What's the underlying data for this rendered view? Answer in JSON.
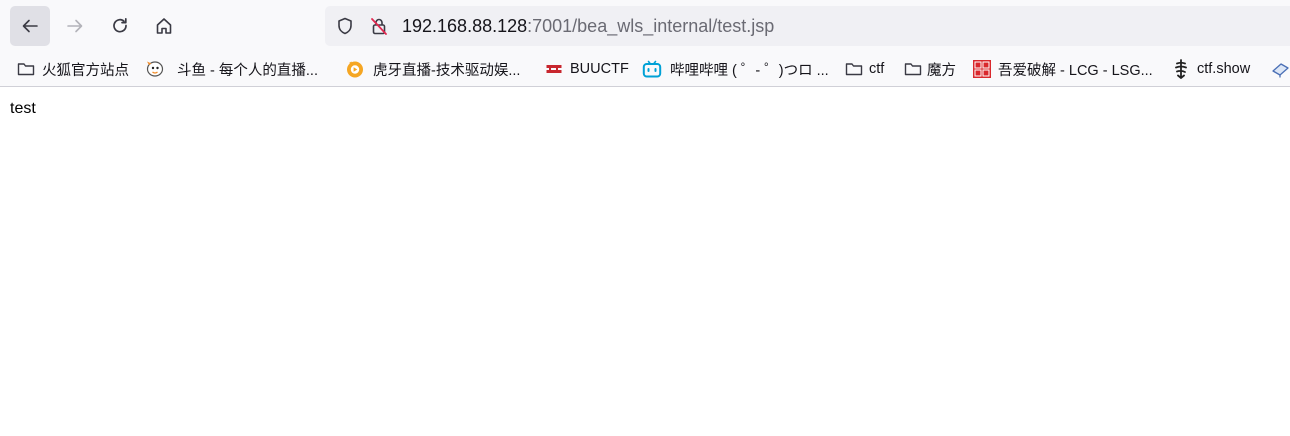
{
  "toolbar": {
    "back_icon": "arrow-left-icon",
    "forward_icon": "arrow-right-icon",
    "reload_icon": "reload-icon",
    "home_icon": "home-icon"
  },
  "urlbar": {
    "host": "192.168.88.128",
    "path": ":7001/bea_wls_internal/test.jsp",
    "shield_icon": "tracking-protection-shield-icon",
    "lock_icon": "insecure-lock-icon"
  },
  "bookmarks": [
    {
      "label": "火狐官方站点",
      "icon": "folder-icon"
    },
    {
      "label": "斗鱼 - 每个人的直播...",
      "icon": "douyu-icon"
    },
    {
      "label": "虎牙直播-技术驱动娱...",
      "icon": "huya-icon"
    },
    {
      "label": "BUUCTF",
      "icon": "buuctf-icon"
    },
    {
      "label": "哔哩哔哩 ( ゜- ゜)つロ ...",
      "icon": "bilibili-icon"
    },
    {
      "label": "ctf",
      "icon": "folder-icon"
    },
    {
      "label": "魔方",
      "icon": "folder-icon"
    },
    {
      "label": "吾爱破解 - LCG - LSG...",
      "icon": "52pojie-icon"
    },
    {
      "label": "ctf.show",
      "icon": "ctfshow-icon"
    }
  ],
  "page": {
    "text": "test"
  },
  "colors": {
    "toolbar_bg": "#f9f9fb",
    "urlbar_bg": "#f0f0f4",
    "bilibili": "#00a1d6",
    "pojie_red": "#d9282d"
  }
}
